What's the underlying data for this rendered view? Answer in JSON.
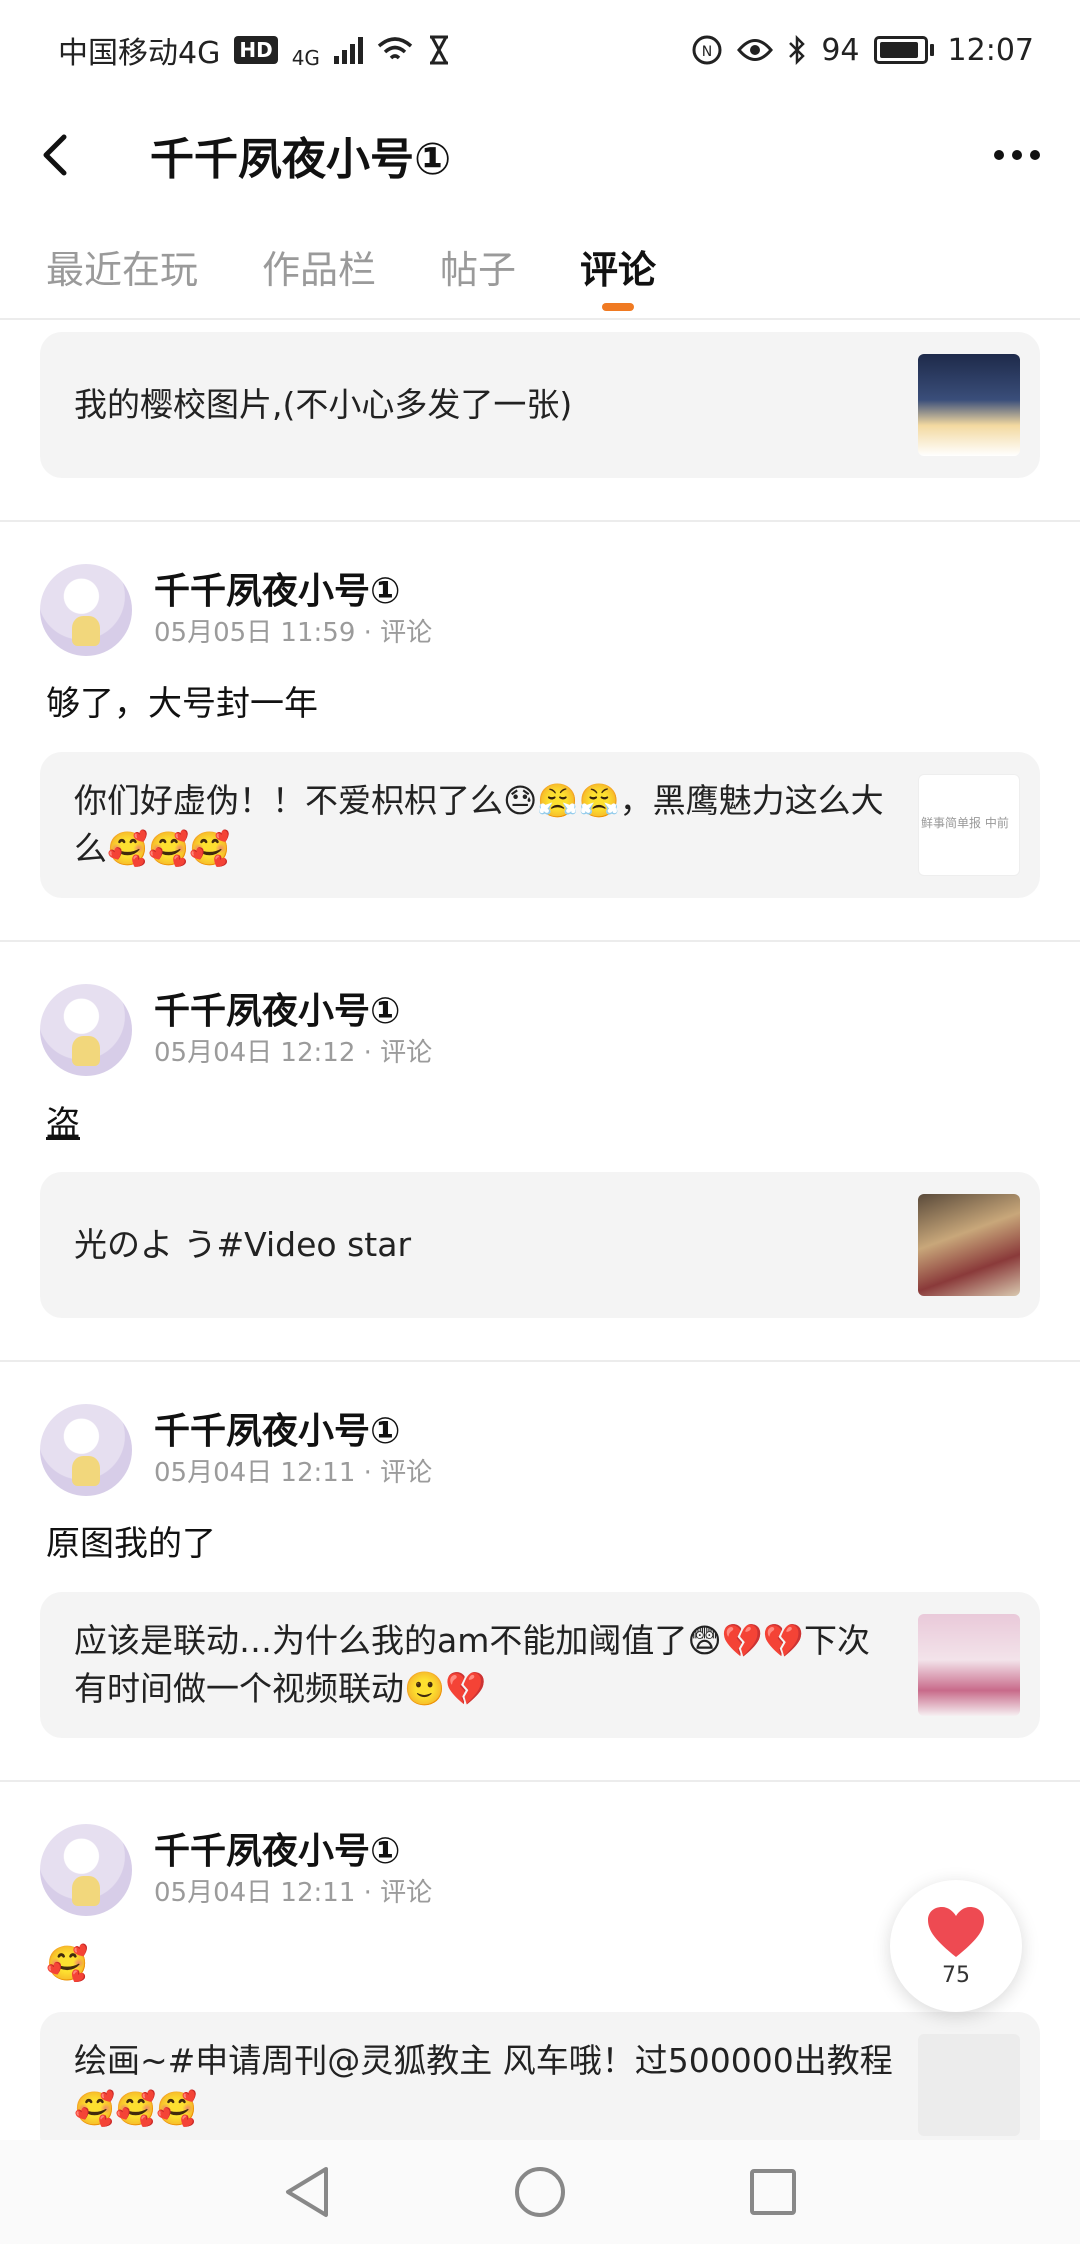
{
  "status_bar": {
    "carrier": "中国移动4G",
    "hd": "HD",
    "network": "4G",
    "battery": "94",
    "time": "12:07"
  },
  "header": {
    "title": "千千夙夜小号①"
  },
  "tabs": [
    {
      "label": "最近在玩"
    },
    {
      "label": "作品栏"
    },
    {
      "label": "帖子"
    },
    {
      "label": "评论"
    }
  ],
  "active_tab": "评论",
  "feed": {
    "top_card": {
      "text": "我的樱校图片,(不小心多发了一张)"
    },
    "posts": [
      {
        "name": "千千夙夜小号①",
        "time": "05月05日 11:59 · 评论",
        "body": "够了，大号封一年",
        "card": "你们好虚伪！！不爱枳枳了么😓😤😤，黑鹰魅力这么大么🥰🥰🥰",
        "thumb_text": "鲜事简单报 中前"
      },
      {
        "name": "千千夙夜小号①",
        "time": "05月04日 12:12 · 评论",
        "body": "盗",
        "card": "光のよ う#Video star"
      },
      {
        "name": "千千夙夜小号①",
        "time": "05月04日 12:11 · 评论",
        "body": "原图我的了",
        "card": "应该是联动…为什么我的am不能加阈值了😨💔💔下次有时间做一个视频联动🙂💔"
      },
      {
        "name": "千千夙夜小号①",
        "time": "05月04日 12:11 · 评论",
        "body": "🥰",
        "card": "绘画~#申请周刊@灵狐教主 风车哦！过500000出教程🥰🥰🥰"
      }
    ]
  },
  "like": {
    "count": "75"
  },
  "colors": {
    "accent": "#f07a22",
    "like": "#ee4a52",
    "card_bg": "#f4f4f4"
  }
}
